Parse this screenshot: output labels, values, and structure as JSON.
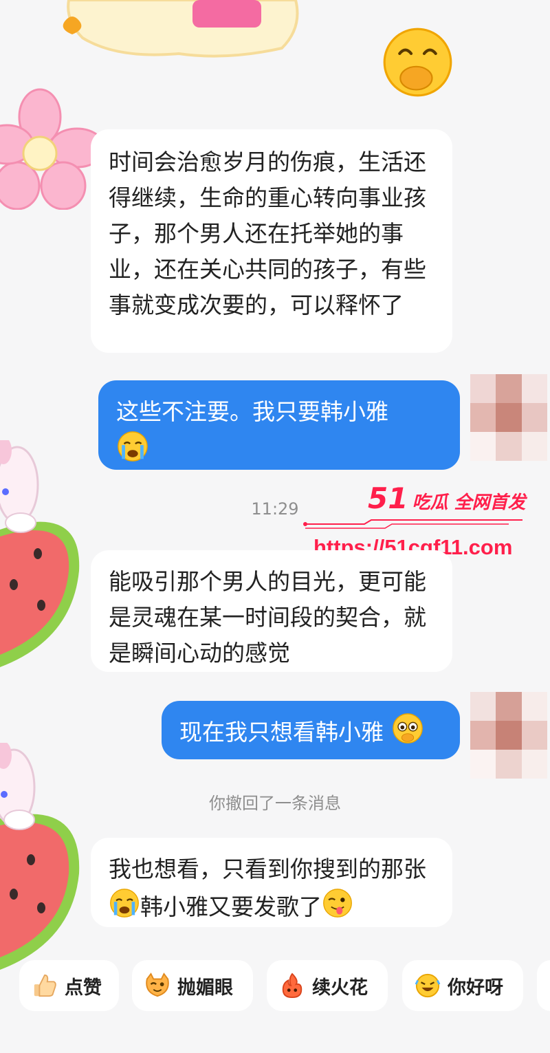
{
  "messages": [
    {
      "side": "left",
      "text": "时间会治愈岁月的伤痕，生活还得继续，生命的重心转向事业孩子，那个男人还在托举她的事业，还在关心共同的孩子，有些事就变成次要的，可以释怀了"
    },
    {
      "side": "right",
      "text": "这些不注要。我只要韩小雅",
      "emoji": "loudly-crying-emoji"
    },
    {
      "side": "left",
      "text": "能吸引那个男人的目光，更可能是灵魂在某一时间段的契合，就是瞬间心动的感觉"
    },
    {
      "side": "right",
      "text": "现在我只想看韩小雅",
      "emoji": "pleading-face-emoji"
    },
    {
      "side": "left",
      "text_before": "我也想看，只看到你搜到的那张",
      "emoji1": "loudly-crying-emoji",
      "text_after": "韩小雅又要发歌了",
      "emoji2": "winking-tongue-emoji"
    }
  ],
  "timestamp": "11:29",
  "recall_notice": "你撤回了一条消息",
  "watermark": {
    "brand_num": "51",
    "brand_text": "吃瓜 全网首发",
    "url": "https://51cgf11.com"
  },
  "quick_replies": [
    {
      "label": "点赞",
      "icon": "thumbs-up-icon"
    },
    {
      "label": "抛媚眼",
      "icon": "wink-cat-icon"
    },
    {
      "label": "续火花",
      "icon": "fire-sticker-icon"
    },
    {
      "label": "你好呀",
      "icon": "laughing-face-icon"
    }
  ],
  "colors": {
    "background": "#f6f6f7",
    "incoming": "#ffffff",
    "outgoing": "#2f86f0",
    "watermark": "#ff1f4b"
  }
}
